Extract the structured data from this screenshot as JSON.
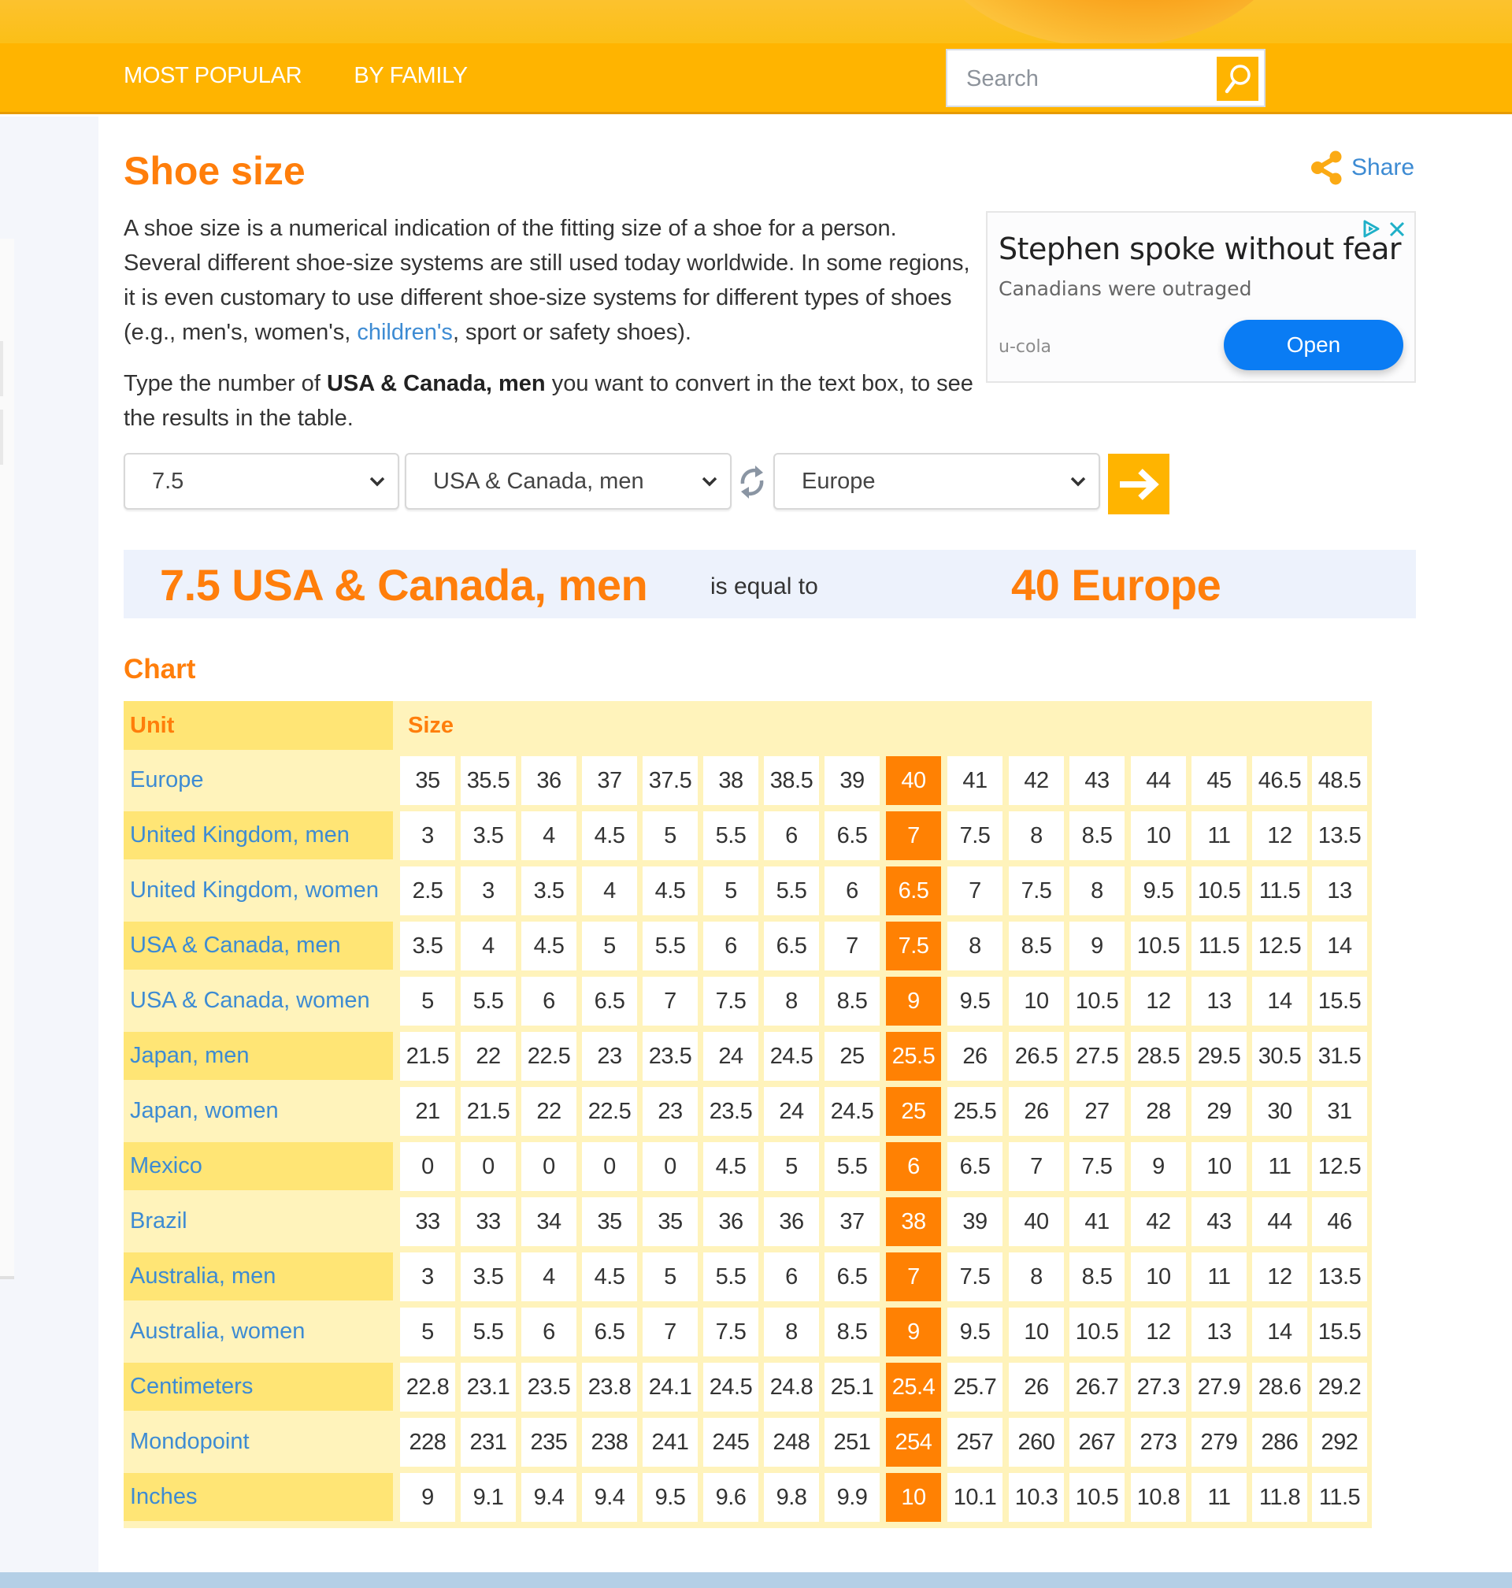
{
  "header": {
    "nav": [
      "MOST POPULAR",
      "BY FAMILY"
    ],
    "search_placeholder": "Search"
  },
  "page": {
    "title": "Shoe size",
    "share_label": "Share",
    "description_before_link": "A shoe size is a numerical indication of the fitting size of a shoe for a person. Several different shoe-size systems are still used today worldwide. In some regions, it is even customary to use different shoe-size systems for different types of shoes (e.g., men's, women's, ",
    "description_link": "children's",
    "description_after_link": ", sport or safety shoes).",
    "instruction_before": "Type the number of ",
    "instruction_bold": "USA & Canada, men",
    "instruction_after": " you want to convert in the text box, to see the results in the table."
  },
  "ad": {
    "headline": "Stephen spoke without fear",
    "subline": "Canadians were outraged",
    "brand": "u-cola",
    "cta": "Open"
  },
  "converter": {
    "value": "7.5",
    "from_unit": "USA & Canada, men",
    "to_unit": "Europe"
  },
  "result": {
    "from_text": "7.5 USA & Canada, men",
    "equal_text": "is equal to",
    "to_text": "40 Europe"
  },
  "chart": {
    "heading": "Chart",
    "col_unit": "Unit",
    "col_size": "Size",
    "highlight_index": 8,
    "colors": {
      "highlight": "#ff8103",
      "accent": "#ff7e0b",
      "link": "#3d8bd3"
    },
    "rows": [
      {
        "unit": "Europe",
        "values": [
          "35",
          "35.5",
          "36",
          "37",
          "37.5",
          "38",
          "38.5",
          "39",
          "40",
          "41",
          "42",
          "43",
          "44",
          "45",
          "46.5",
          "48.5"
        ]
      },
      {
        "unit": "United Kingdom, men",
        "values": [
          "3",
          "3.5",
          "4",
          "4.5",
          "5",
          "5.5",
          "6",
          "6.5",
          "7",
          "7.5",
          "8",
          "8.5",
          "10",
          "11",
          "12",
          "13.5"
        ]
      },
      {
        "unit": "United Kingdom, women",
        "values": [
          "2.5",
          "3",
          "3.5",
          "4",
          "4.5",
          "5",
          "5.5",
          "6",
          "6.5",
          "7",
          "7.5",
          "8",
          "9.5",
          "10.5",
          "11.5",
          "13"
        ]
      },
      {
        "unit": "USA & Canada, men",
        "values": [
          "3.5",
          "4",
          "4.5",
          "5",
          "5.5",
          "6",
          "6.5",
          "7",
          "7.5",
          "8",
          "8.5",
          "9",
          "10.5",
          "11.5",
          "12.5",
          "14"
        ]
      },
      {
        "unit": "USA & Canada, women",
        "values": [
          "5",
          "5.5",
          "6",
          "6.5",
          "7",
          "7.5",
          "8",
          "8.5",
          "9",
          "9.5",
          "10",
          "10.5",
          "12",
          "13",
          "14",
          "15.5"
        ]
      },
      {
        "unit": "Japan, men",
        "values": [
          "21.5",
          "22",
          "22.5",
          "23",
          "23.5",
          "24",
          "24.5",
          "25",
          "25.5",
          "26",
          "26.5",
          "27.5",
          "28.5",
          "29.5",
          "30.5",
          "31.5"
        ]
      },
      {
        "unit": "Japan, women",
        "values": [
          "21",
          "21.5",
          "22",
          "22.5",
          "23",
          "23.5",
          "24",
          "24.5",
          "25",
          "25.5",
          "26",
          "27",
          "28",
          "29",
          "30",
          "31"
        ]
      },
      {
        "unit": "Mexico",
        "values": [
          "0",
          "0",
          "0",
          "0",
          "0",
          "4.5",
          "5",
          "5.5",
          "6",
          "6.5",
          "7",
          "7.5",
          "9",
          "10",
          "11",
          "12.5"
        ]
      },
      {
        "unit": "Brazil",
        "values": [
          "33",
          "33",
          "34",
          "35",
          "35",
          "36",
          "36",
          "37",
          "38",
          "39",
          "40",
          "41",
          "42",
          "43",
          "44",
          "46"
        ]
      },
      {
        "unit": "Australia, men",
        "values": [
          "3",
          "3.5",
          "4",
          "4.5",
          "5",
          "5.5",
          "6",
          "6.5",
          "7",
          "7.5",
          "8",
          "8.5",
          "10",
          "11",
          "12",
          "13.5"
        ]
      },
      {
        "unit": "Australia, women",
        "values": [
          "5",
          "5.5",
          "6",
          "6.5",
          "7",
          "7.5",
          "8",
          "8.5",
          "9",
          "9.5",
          "10",
          "10.5",
          "12",
          "13",
          "14",
          "15.5"
        ]
      },
      {
        "unit": "Centimeters",
        "values": [
          "22.8",
          "23.1",
          "23.5",
          "23.8",
          "24.1",
          "24.5",
          "24.8",
          "25.1",
          "25.4",
          "25.7",
          "26",
          "26.7",
          "27.3",
          "27.9",
          "28.6",
          "29.2"
        ]
      },
      {
        "unit": "Mondopoint",
        "values": [
          "228",
          "231",
          "235",
          "238",
          "241",
          "245",
          "248",
          "251",
          "254",
          "257",
          "260",
          "267",
          "273",
          "279",
          "286",
          "292"
        ]
      },
      {
        "unit": "Inches",
        "values": [
          "9",
          "9.1",
          "9.4",
          "9.4",
          "9.5",
          "9.6",
          "9.8",
          "9.9",
          "10",
          "10.1",
          "10.3",
          "10.5",
          "10.8",
          "11",
          "11.8",
          "11.5"
        ]
      }
    ]
  }
}
